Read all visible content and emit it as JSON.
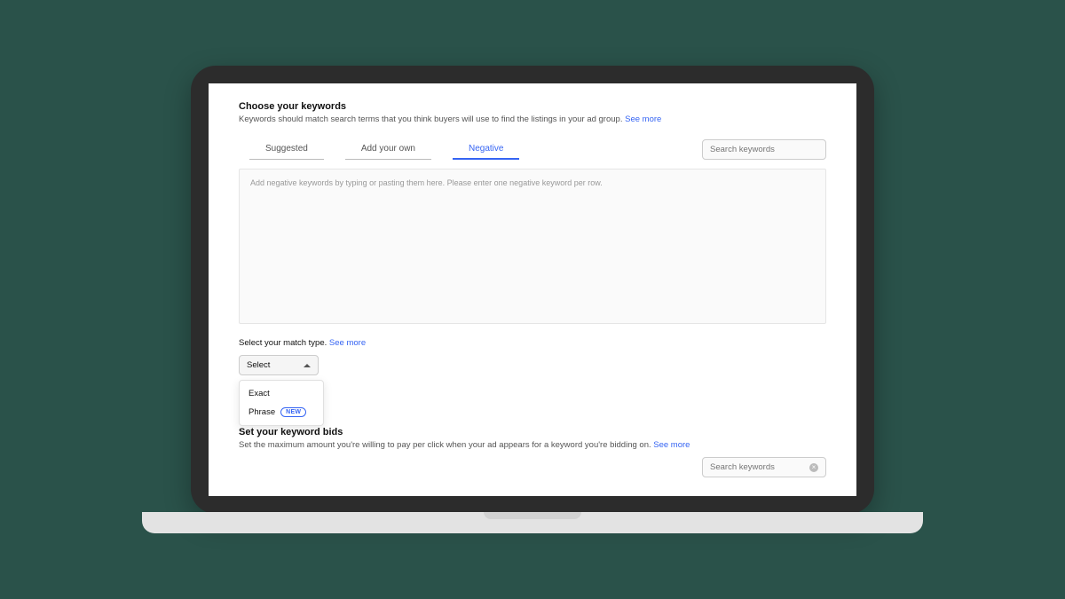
{
  "keywords_section": {
    "title": "Choose your keywords",
    "desc": "Keywords should match search terms that you think buyers will use to find the listings in your ad group.",
    "see_more": "See more"
  },
  "search": {
    "placeholder": "Search keywords"
  },
  "tabs": {
    "suggested": "Suggested",
    "add_own": "Add your own",
    "negative": "Negative"
  },
  "negative_textarea": {
    "placeholder": "Add negative keywords by typing or pasting them here. Please enter one negative keyword per row."
  },
  "match_type": {
    "label": "Select your match type.",
    "see_more": "See more",
    "select_label": "Select",
    "options": {
      "exact": "Exact",
      "phrase": "Phrase",
      "new_badge": "NEW"
    }
  },
  "bids_section": {
    "title": "Set your keyword bids",
    "desc": "Set the maximum amount you're willing to pay per click when your ad appears for a keyword you're bidding on.",
    "see_more": "See more",
    "search_placeholder": "Search keywords"
  }
}
